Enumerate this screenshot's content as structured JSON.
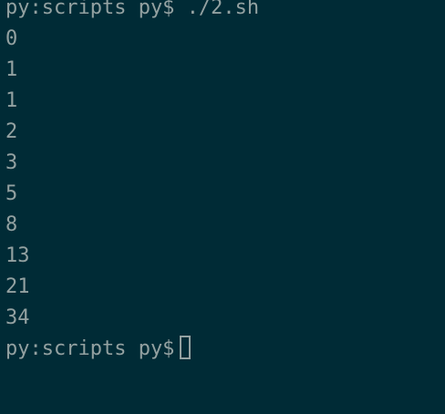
{
  "terminal": {
    "lines": [
      {
        "prompt": "py:scripts py$",
        "command": "./2.sh"
      },
      {
        "output": "0"
      },
      {
        "output": "1"
      },
      {
        "output": "1"
      },
      {
        "output": "2"
      },
      {
        "output": "3"
      },
      {
        "output": "5"
      },
      {
        "output": "8"
      },
      {
        "output": "13"
      },
      {
        "output": "21"
      },
      {
        "output": "34"
      },
      {
        "prompt": "py:scripts py$",
        "command": ""
      }
    ],
    "background": "#002b36",
    "foreground": "#93a1a1"
  }
}
